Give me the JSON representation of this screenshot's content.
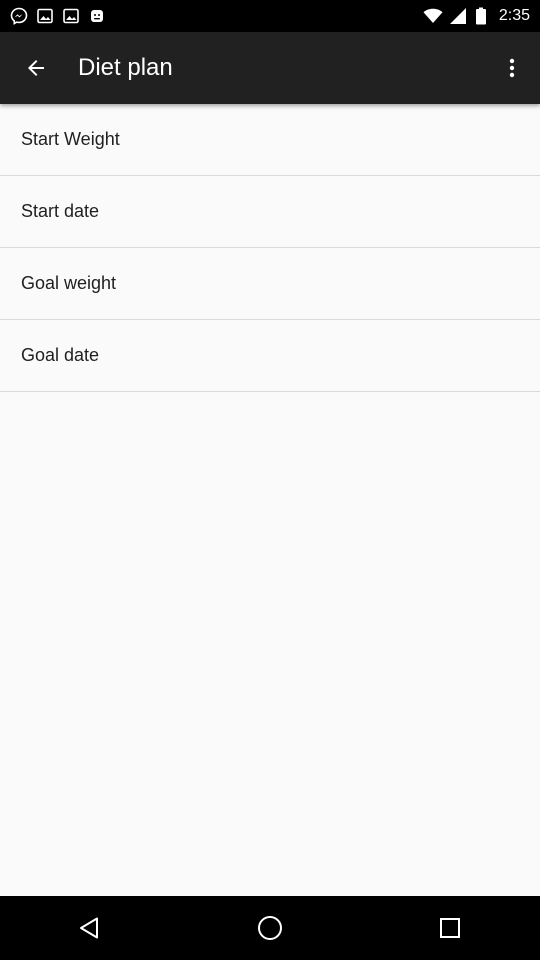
{
  "status_bar": {
    "time": "2:35",
    "left_icons": [
      "messenger-icon",
      "image-icon",
      "image-icon",
      "android-icon"
    ],
    "right_icons": [
      "wifi-icon",
      "signal-icon",
      "battery-icon"
    ]
  },
  "app_bar": {
    "title": "Diet plan",
    "back_icon": "arrow-back-icon",
    "menu_icon": "more-vert-icon"
  },
  "list": {
    "items": [
      {
        "label": "Start Weight"
      },
      {
        "label": "Start date"
      },
      {
        "label": "Goal weight"
      },
      {
        "label": "Goal date"
      }
    ]
  },
  "nav_bar": {
    "buttons": [
      "back-triangle-icon",
      "home-circle-icon",
      "recents-square-icon"
    ]
  },
  "colors": {
    "app_bar": "#212121",
    "background": "#fafafa",
    "divider": "#d9d9d9",
    "text_primary": "#212121"
  }
}
